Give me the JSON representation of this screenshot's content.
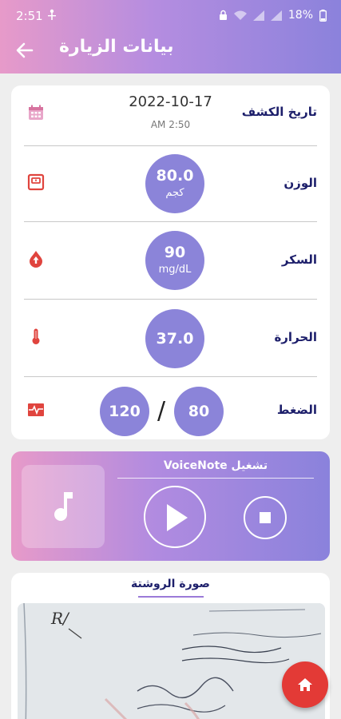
{
  "status_bar": {
    "time": "2:51",
    "battery": "18%"
  },
  "app_bar": {
    "title": "بيانات الزيارة"
  },
  "visit": {
    "exam_date": {
      "label": "تاريخ الكشف",
      "date": "2022-10-17",
      "time": "AM 2:50"
    },
    "weight": {
      "label": "الوزن",
      "value": "80.0",
      "unit": "كجم"
    },
    "sugar": {
      "label": "السكر",
      "value": "90",
      "unit": "mg/dL"
    },
    "temperature": {
      "label": "الحرارة",
      "value": "37.0"
    },
    "pressure": {
      "label": "الضغط",
      "systolic": "120",
      "separator": "/",
      "diastolic": "80"
    }
  },
  "voice_note": {
    "title": "تشغيل VoiceNote"
  },
  "prescription": {
    "title": "صورة الروشتة"
  },
  "icons": {
    "calendar": "calendar-icon",
    "scale": "scale-icon",
    "drop": "blood-drop-icon",
    "thermometer": "thermometer-icon",
    "pulse": "heart-monitor-icon",
    "music": "music-note-icon",
    "play": "play-icon",
    "stop": "stop-icon",
    "home": "home-icon"
  },
  "colors": {
    "accent": "#8b84d9",
    "label": "#1d1f6b",
    "icon": "#e0443e",
    "fab": "#e33a36"
  }
}
